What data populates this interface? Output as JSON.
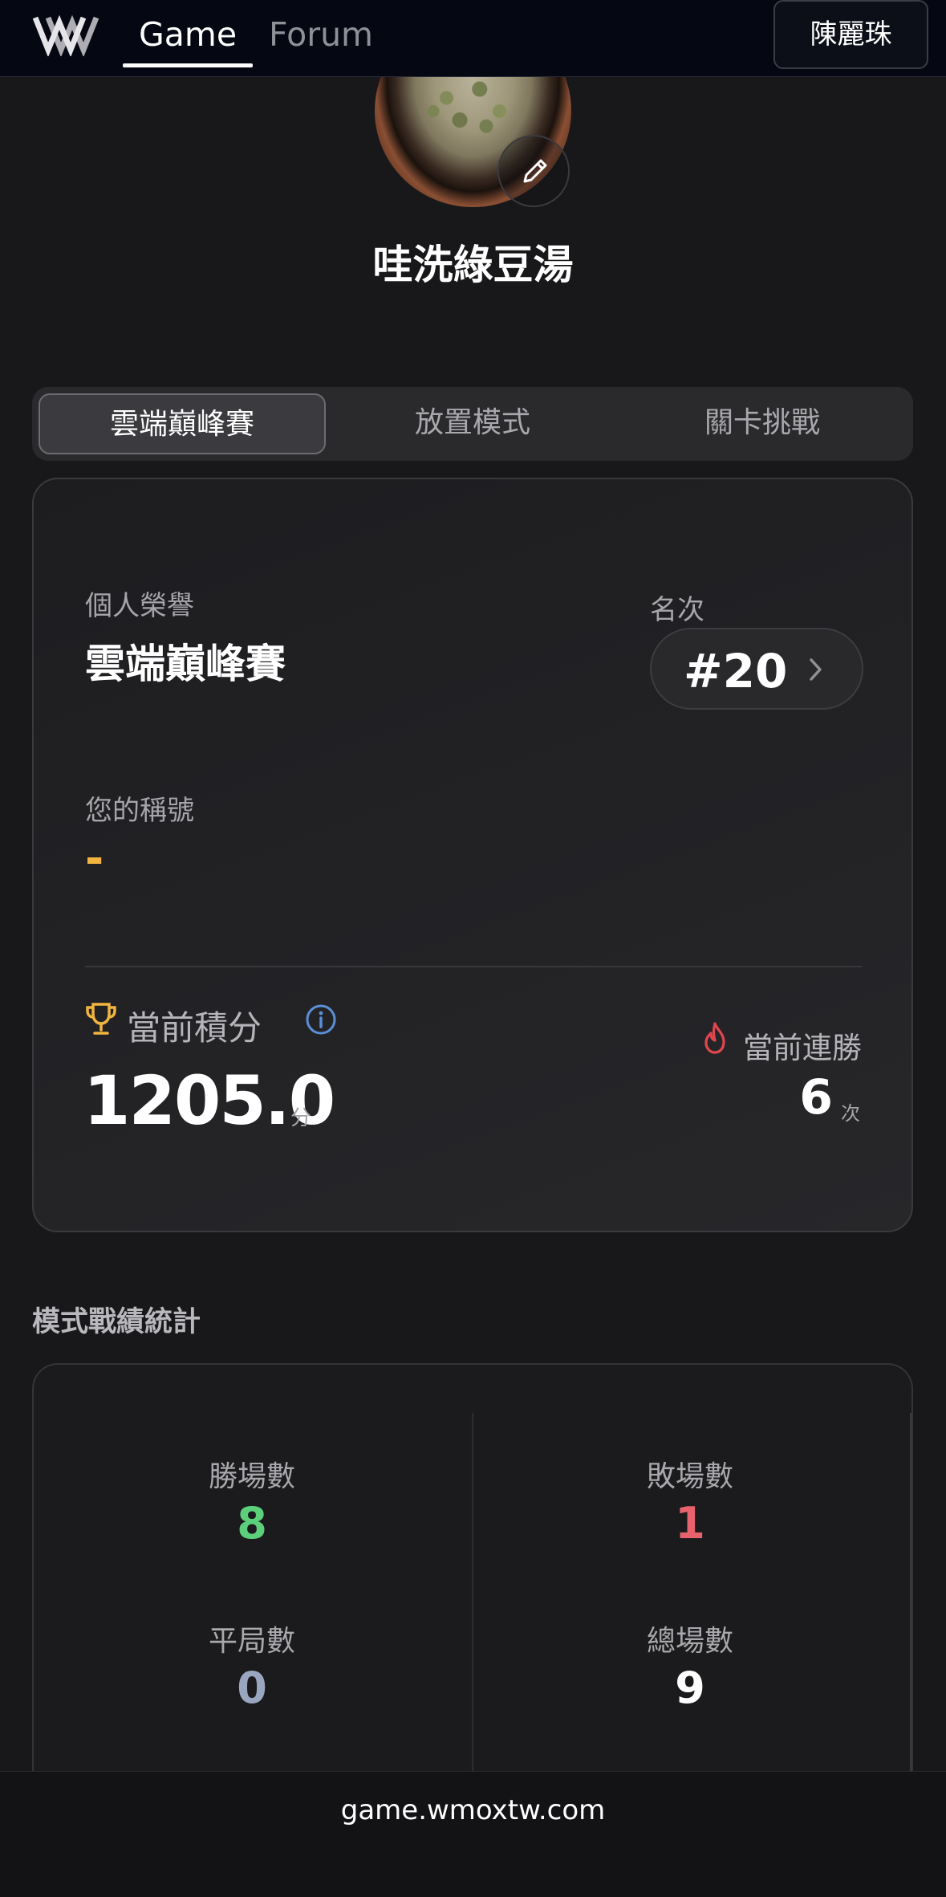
{
  "nav": {
    "tabs": [
      {
        "label": "Game",
        "active": true
      },
      {
        "label": "Forum",
        "active": false
      }
    ],
    "user_button": "陳麗珠"
  },
  "profile": {
    "username": "哇洗綠豆湯",
    "avatar": "mung-bean-soup-photo"
  },
  "mode_tabs": [
    {
      "label": "雲端巔峰賽",
      "active": true
    },
    {
      "label": "放置模式",
      "active": false
    },
    {
      "label": "關卡挑戰",
      "active": false
    }
  ],
  "honor": {
    "section_label": "個人榮譽",
    "mode_title": "雲端巔峰賽",
    "rank_label": "名次",
    "rank_value": "#20",
    "title_label": "您的稱號",
    "title_value": "-",
    "score_label": "當前積分",
    "score_value": "1205.0",
    "score_unit": "分",
    "streak_label": "當前連勝",
    "streak_value": "6",
    "streak_unit": "次"
  },
  "stats": {
    "section_title": "模式戰績統計",
    "items": [
      {
        "label": "勝場數",
        "value": "8",
        "color": "#5ccf7a"
      },
      {
        "label": "敗場數",
        "value": "1",
        "color": "#e8626e"
      },
      {
        "label": "平局數",
        "value": "0",
        "color": "#9aa6c0"
      },
      {
        "label": "總場數",
        "value": "9",
        "color": "#ffffff"
      }
    ]
  },
  "footer": {
    "url": "game.wmoxtw.com"
  },
  "colors": {
    "accent_gold": "#f1b53f",
    "info_blue": "#5b8fd6",
    "flame_red": "#e0464e"
  }
}
